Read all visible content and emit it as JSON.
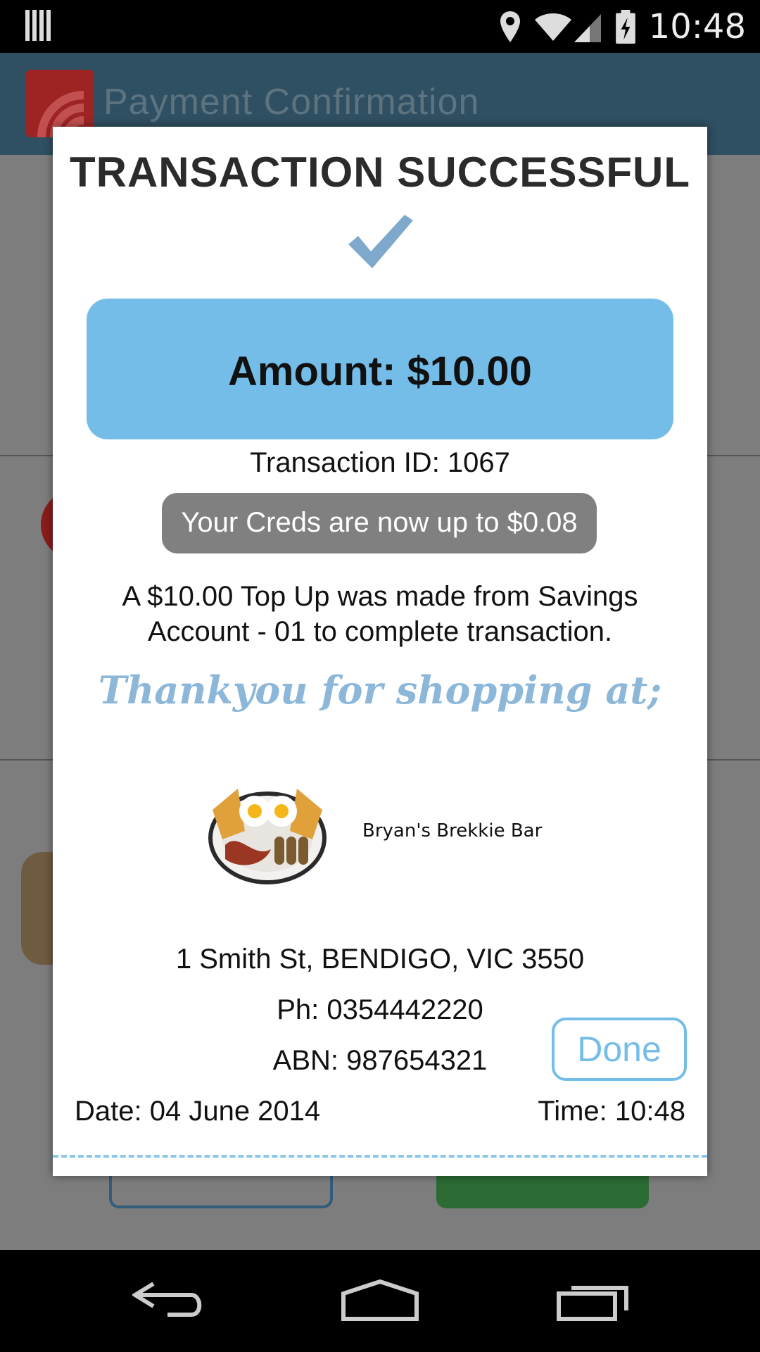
{
  "status_bar": {
    "time": "10:48",
    "icons": [
      "barcode-icon",
      "location-icon",
      "wifi-icon",
      "signal-icon",
      "battery-charging-icon"
    ]
  },
  "app_bar": {
    "title": "Payment Confirmation",
    "logo_color": "#9e2424",
    "background": "#2f4f62"
  },
  "dialog": {
    "title": "TRANSACTION SUCCESSFUL",
    "amount": "Amount: $10.00",
    "transaction_id": "Transaction ID: 1067",
    "creds": "Your Creds are now up to $0.08",
    "topup_line1": "A $10.00 Top Up was made from Savings",
    "topup_line2": "Account - 01 to complete transaction.",
    "thankyou": "Thankyou for shopping at;",
    "merchant_name": "Bryan's Brekkie Bar",
    "address": "1 Smith St, BENDIGO, VIC 3550",
    "phone": "Ph: 0354442220",
    "abn": "ABN: 987654321",
    "done_label": "Done",
    "date": "Date: 04 June 2014",
    "time": "Time: 10:48",
    "accent_color": "#74bde8"
  },
  "nav_bar": {
    "icons": [
      "back-icon",
      "home-icon",
      "recent-apps-icon"
    ]
  }
}
